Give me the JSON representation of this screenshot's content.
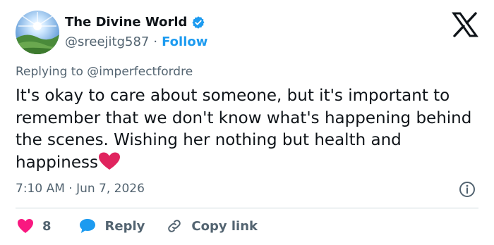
{
  "author": {
    "name": "The Divine World",
    "handle": "@sreejitg587",
    "separator": "·",
    "follow_label": "Follow"
  },
  "replying_to": "Replying to @imperfectfordre",
  "tweet": {
    "text": "It's okay to care about someone, but it's important to remember that we don't know what's happening behind the scenes. Wishing her nothing but health and happiness"
  },
  "timestamp": "7:10 AM · Jun 7, 2026",
  "actions": {
    "like_count": "8",
    "reply_label": "Reply",
    "copy_link_label": "Copy link"
  },
  "colors": {
    "accent": "#1d9bf0",
    "heart": "#f91880",
    "emoji_heart": "#e0245e",
    "text_primary": "#0f1419",
    "text_secondary": "#536471",
    "divider": "#cfd9de"
  },
  "icons": [
    "verified-badge-icon",
    "x-logo-icon",
    "info-icon",
    "heart-icon",
    "reply-bubble-icon",
    "link-icon",
    "red-heart-emoji-icon"
  ]
}
